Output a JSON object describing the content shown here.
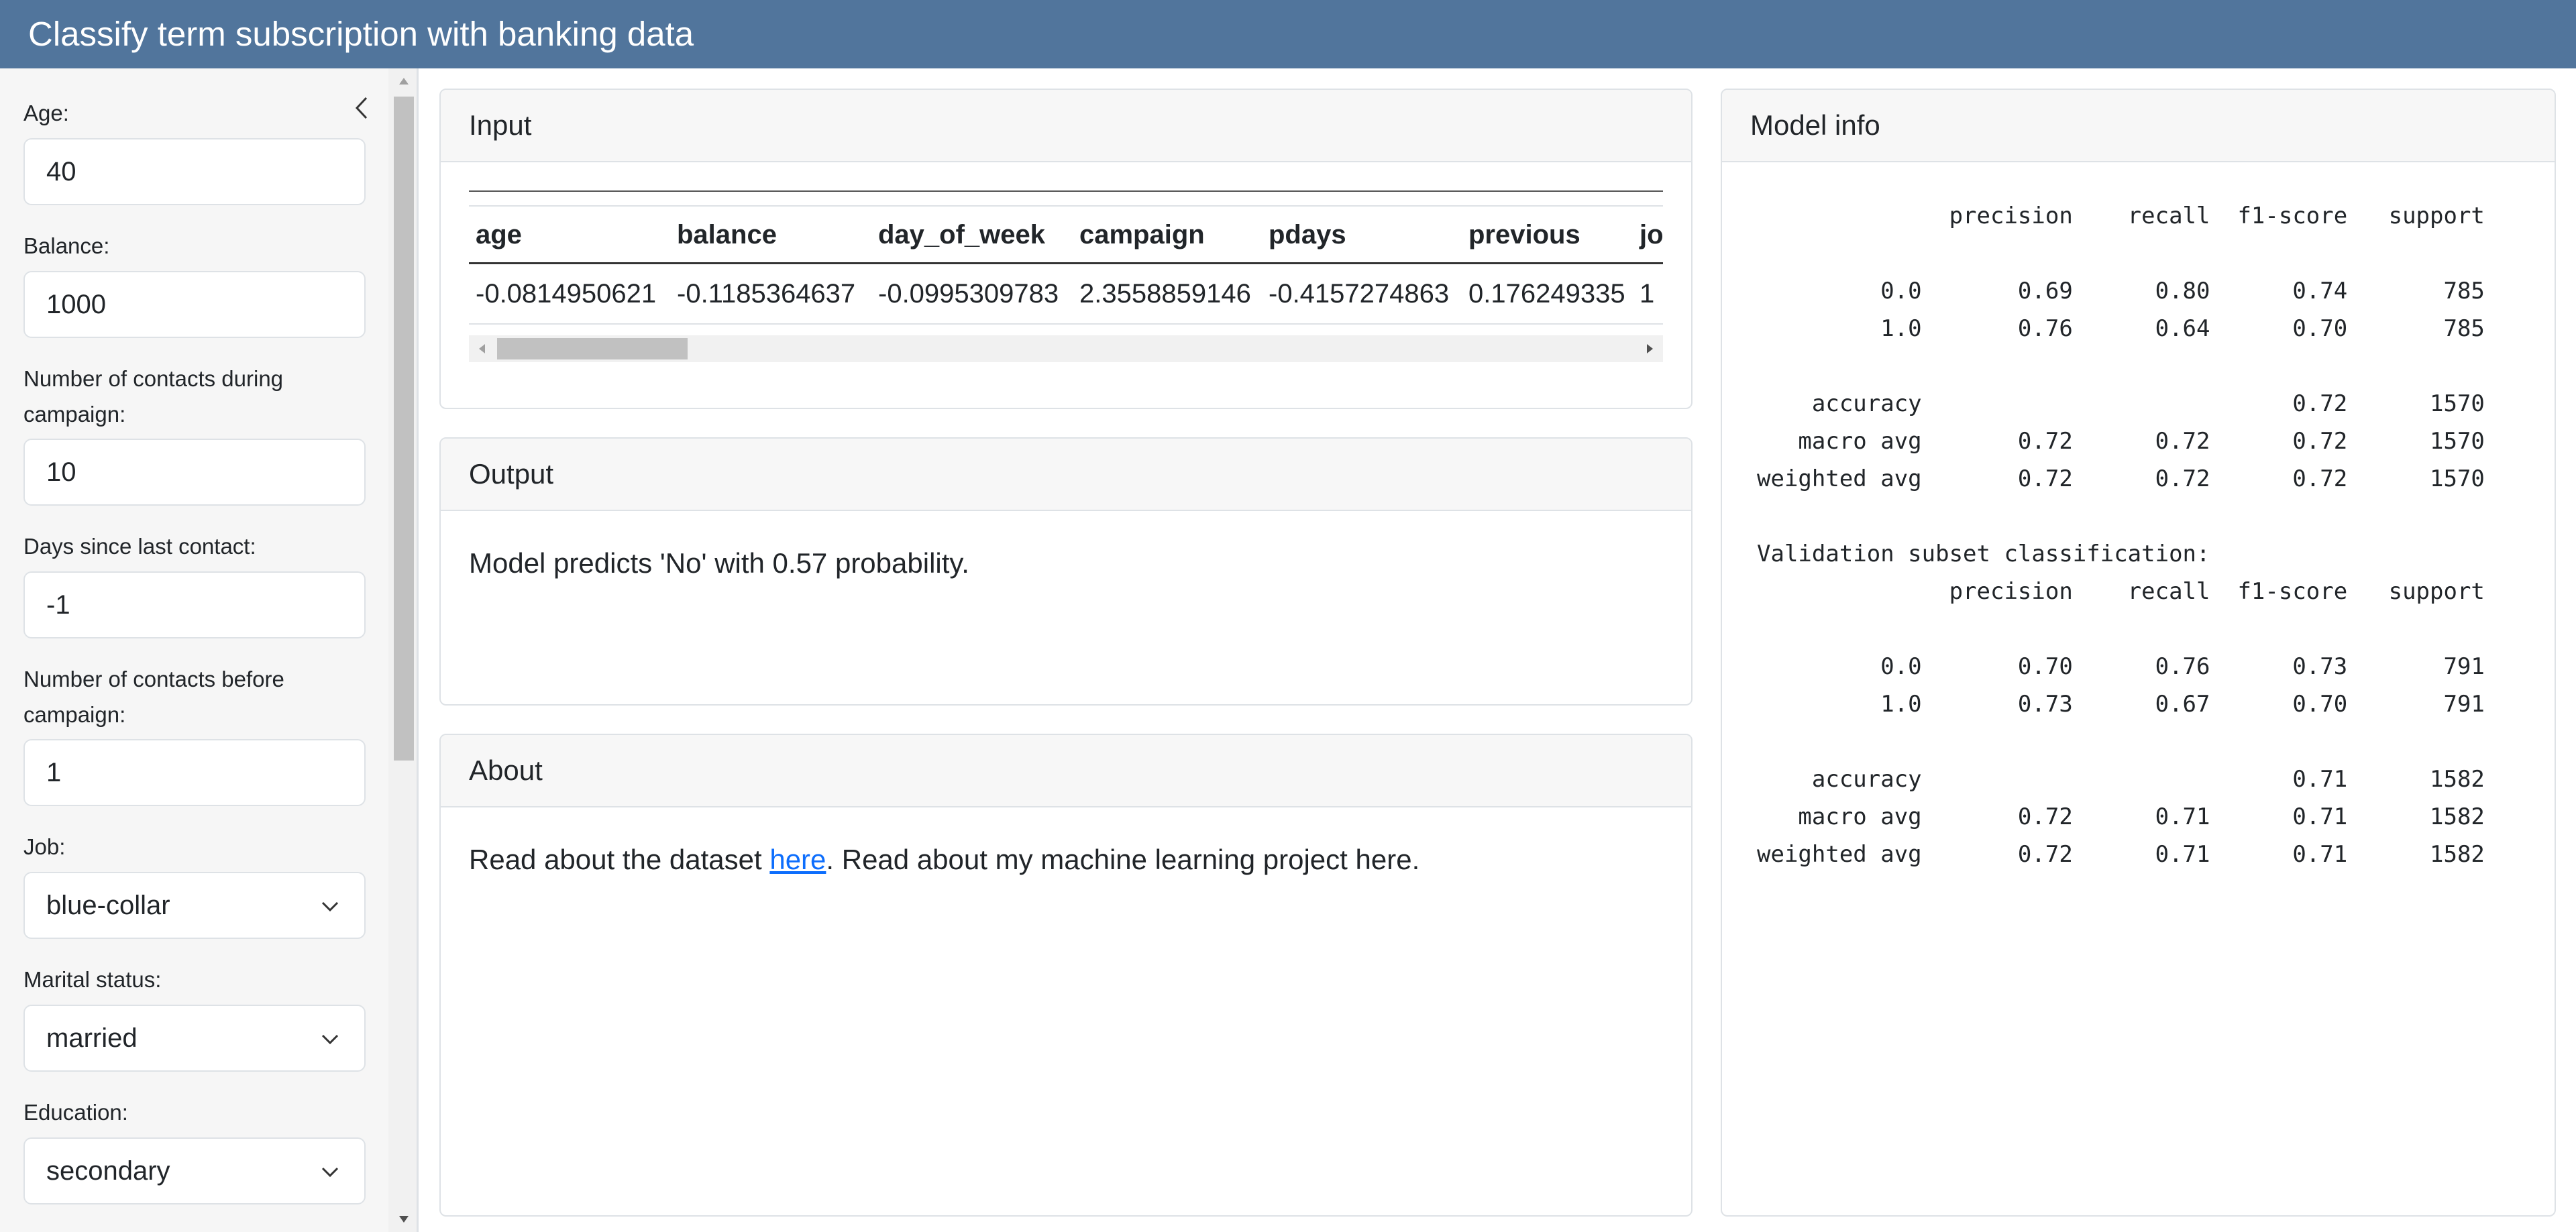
{
  "app": {
    "title": "Classify term subscription with banking data"
  },
  "sidebar": {
    "fields": [
      {
        "label": "Age:",
        "value": "40",
        "type": "input"
      },
      {
        "label": "Balance:",
        "value": "1000",
        "type": "input"
      },
      {
        "label": "Number of contacts during campaign:",
        "value": "10",
        "type": "input"
      },
      {
        "label": "Days since last contact:",
        "value": "-1",
        "type": "input"
      },
      {
        "label": "Number of contacts before campaign:",
        "value": "1",
        "type": "input"
      },
      {
        "label": "Job:",
        "value": "blue-collar",
        "type": "select"
      },
      {
        "label": "Marital status:",
        "value": "married",
        "type": "select"
      },
      {
        "label": "Education:",
        "value": "secondary",
        "type": "select"
      }
    ]
  },
  "input_card": {
    "header": "Input",
    "columns": [
      "age",
      "balance",
      "day_of_week",
      "campaign",
      "pdays",
      "previous",
      "jo"
    ],
    "row": [
      "-0.0814950621",
      "-0.1185364637",
      "-0.0995309783",
      "2.3558859146",
      "-0.4157274863",
      "0.176249335",
      "1"
    ]
  },
  "output_card": {
    "header": "Output",
    "text": "Model predicts 'No' with 0.57 probability."
  },
  "about_card": {
    "header": "About",
    "text_before": "Read about the dataset ",
    "link_text": "here",
    "text_after": ". Read about my machine learning project here."
  },
  "model_info": {
    "header": "Model info",
    "report": "              precision    recall  f1-score   support\n\n         0.0       0.69      0.80      0.74       785\n         1.0       0.76      0.64      0.70       785\n\n    accuracy                           0.72      1570\n   macro avg       0.72      0.72      0.72      1570\nweighted avg       0.72      0.72      0.72      1570\n\nValidation subset classification:\n              precision    recall  f1-score   support\n\n         0.0       0.70      0.76      0.73       791\n         1.0       0.73      0.67      0.70       791\n\n    accuracy                           0.71      1582\n   macro avg       0.72      0.71      0.71      1582\nweighted avg       0.72      0.71      0.71      1582"
  }
}
